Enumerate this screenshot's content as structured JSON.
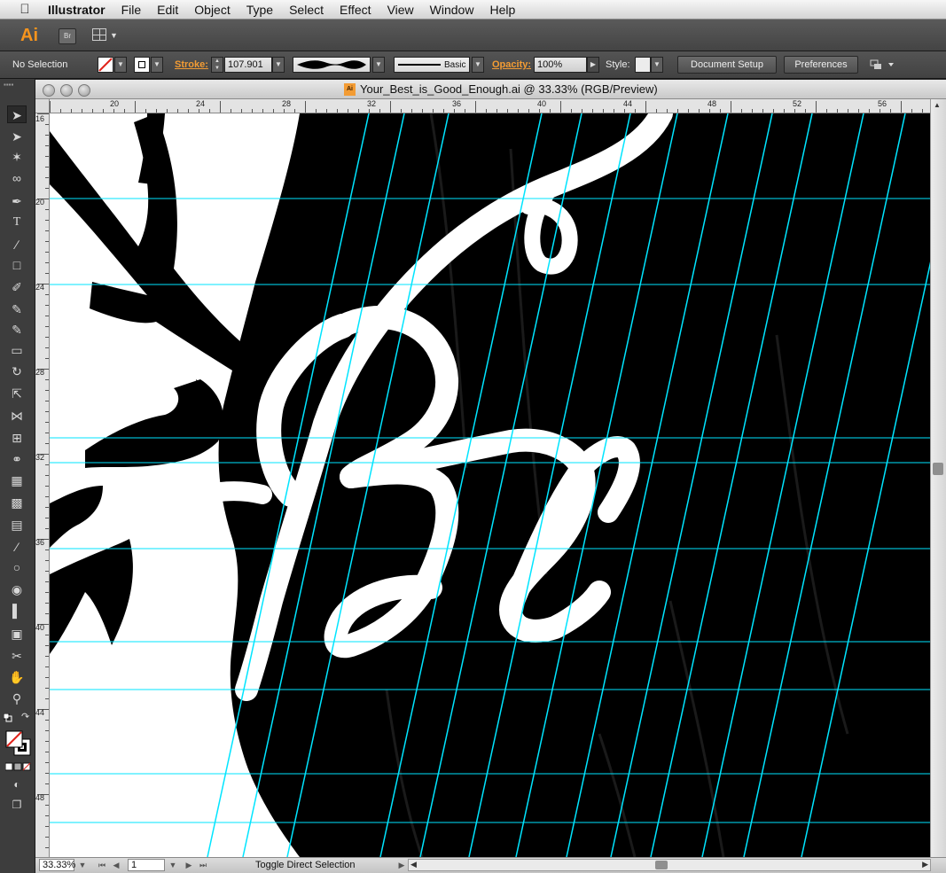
{
  "menubar": {
    "app_name": "Illustrator",
    "items": [
      "File",
      "Edit",
      "Object",
      "Type",
      "Select",
      "Effect",
      "View",
      "Window",
      "Help"
    ]
  },
  "appbar": {
    "logo": "Ai",
    "bridge_label": "Br"
  },
  "control_bar": {
    "selection_status": "No Selection",
    "stroke_label": "Stroke:",
    "stroke_value": "107.901",
    "brush_label": "Basic",
    "opacity_label": "Opacity:",
    "opacity_value": "100%",
    "style_label": "Style:",
    "document_setup_label": "Document Setup",
    "preferences_label": "Preferences"
  },
  "document": {
    "title": "Your_Best_is_Good_Enough.ai @ 33.33% (RGB/Preview)",
    "file_badge": "Ai"
  },
  "rulers": {
    "top_ticks": [
      "20",
      "24",
      "28",
      "32",
      "36",
      "40",
      "44",
      "48",
      "52",
      "56"
    ],
    "left_ticks": [
      "16",
      "20",
      "24",
      "28",
      "32",
      "36",
      "40",
      "44",
      "48"
    ]
  },
  "status_bar": {
    "zoom": "33.33%",
    "artboard": "1",
    "status_text": "Toggle Direct Selection"
  },
  "colors": {
    "guide": "#00e5ff",
    "accent": "#f39c34",
    "canvas_black": "#000000",
    "canvas_white": "#ffffff"
  }
}
